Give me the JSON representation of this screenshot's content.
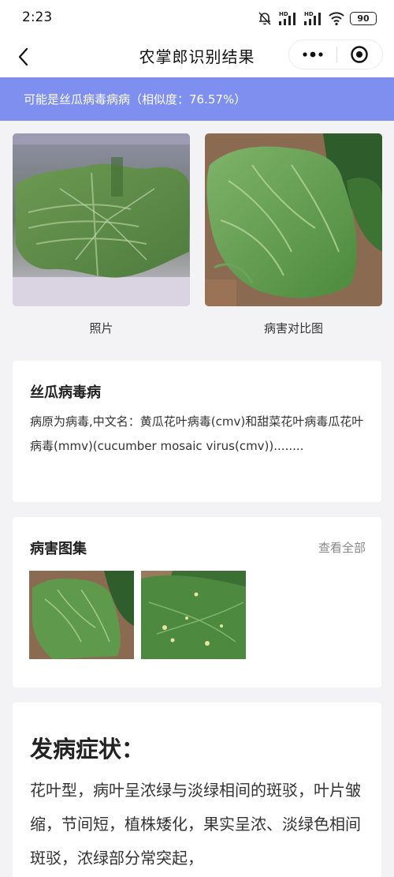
{
  "status_bar": {
    "time": "2:23",
    "battery": "90",
    "icons": [
      "bell-off-icon",
      "signal-icon",
      "signal-icon",
      "wifi-icon",
      "battery-icon"
    ],
    "signal_badge": "HD"
  },
  "nav": {
    "title": "农掌郎识别结果",
    "back_icon": "chevron-left-icon",
    "more_icon": "more-icon",
    "close_icon": "record-icon"
  },
  "result": {
    "text": "可能是丝瓜病毒病病（相似度：76.57%）",
    "accent_color": "#7e8ff0"
  },
  "photos": [
    {
      "caption": "照片"
    },
    {
      "caption": "病害对比图"
    }
  ],
  "disease": {
    "name": "丝瓜病毒病",
    "description": "病原为病毒,中文名：黄瓜花叶病毒(cmv)和甜菜花叶病毒瓜花叶病毒(mmv)(cucumber mosaic virus(cmv))........"
  },
  "gallery": {
    "title": "病害图集",
    "view_all": "查看全部"
  },
  "symptoms": {
    "title": "发病症状：",
    "text": "花叶型，病叶呈浓绿与淡绿相间的斑驳，叶片皱缩，节间短，植株矮化，果实呈浓、淡绿色相间斑驳，浓绿部分常突起，"
  }
}
